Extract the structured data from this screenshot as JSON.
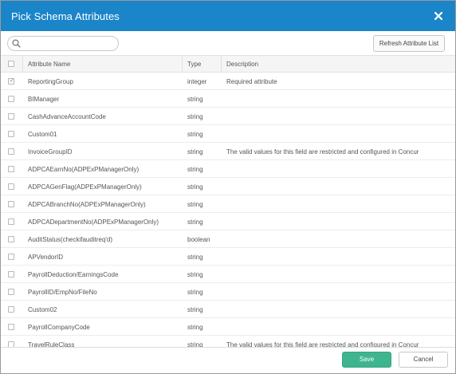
{
  "dialog": {
    "title": "Pick Schema Attributes"
  },
  "toolbar": {
    "search_placeholder": "",
    "search_value": "",
    "refresh_label": "Refresh Attribute List"
  },
  "table": {
    "columns": {
      "name": "Attribute Name",
      "type": "Type",
      "description": "Description"
    },
    "rows": [
      {
        "name": "ReportingGroup",
        "type": "integer",
        "description": "Required attribute",
        "checked": true
      },
      {
        "name": "BIManager",
        "type": "string",
        "description": "",
        "checked": false
      },
      {
        "name": "CashAdvanceAccountCode",
        "type": "string",
        "description": "",
        "checked": false
      },
      {
        "name": "Custom01",
        "type": "string",
        "description": "",
        "checked": false
      },
      {
        "name": "InvoiceGroupID",
        "type": "string",
        "description": "The valid values for this field are restricted and configured in Concur",
        "checked": false
      },
      {
        "name": "ADPCAEarnNo(ADPExPManagerOnly)",
        "type": "string",
        "description": "",
        "checked": false
      },
      {
        "name": "ADPCAGenFlag(ADPExPManagerOnly)",
        "type": "string",
        "description": "",
        "checked": false
      },
      {
        "name": "ADPCABranchNo(ADPExPManagerOnly)",
        "type": "string",
        "description": "",
        "checked": false
      },
      {
        "name": "ADPCADepartmentNo(ADPExPManagerOnly)",
        "type": "string",
        "description": "",
        "checked": false
      },
      {
        "name": "AuditStatus(checkifauditreq'd)",
        "type": "boolean",
        "description": "",
        "checked": false
      },
      {
        "name": "APVendorID",
        "type": "string",
        "description": "",
        "checked": false
      },
      {
        "name": "PayrollDeduction/EarningsCode",
        "type": "string",
        "description": "",
        "checked": false
      },
      {
        "name": "PayrollID/EmpNo/FileNo",
        "type": "string",
        "description": "",
        "checked": false
      },
      {
        "name": "Custom02",
        "type": "string",
        "description": "",
        "checked": false
      },
      {
        "name": "PayrollCompanyCode",
        "type": "string",
        "description": "",
        "checked": false
      },
      {
        "name": "TravelRuleClass",
        "type": "string",
        "description": "The valid values for this field are restricted and configured in Concur",
        "checked": false
      }
    ]
  },
  "footer": {
    "save_label": "Save",
    "cancel_label": "Cancel"
  },
  "colors": {
    "titlebar": "#1b85c9",
    "save": "#3fb58f"
  }
}
